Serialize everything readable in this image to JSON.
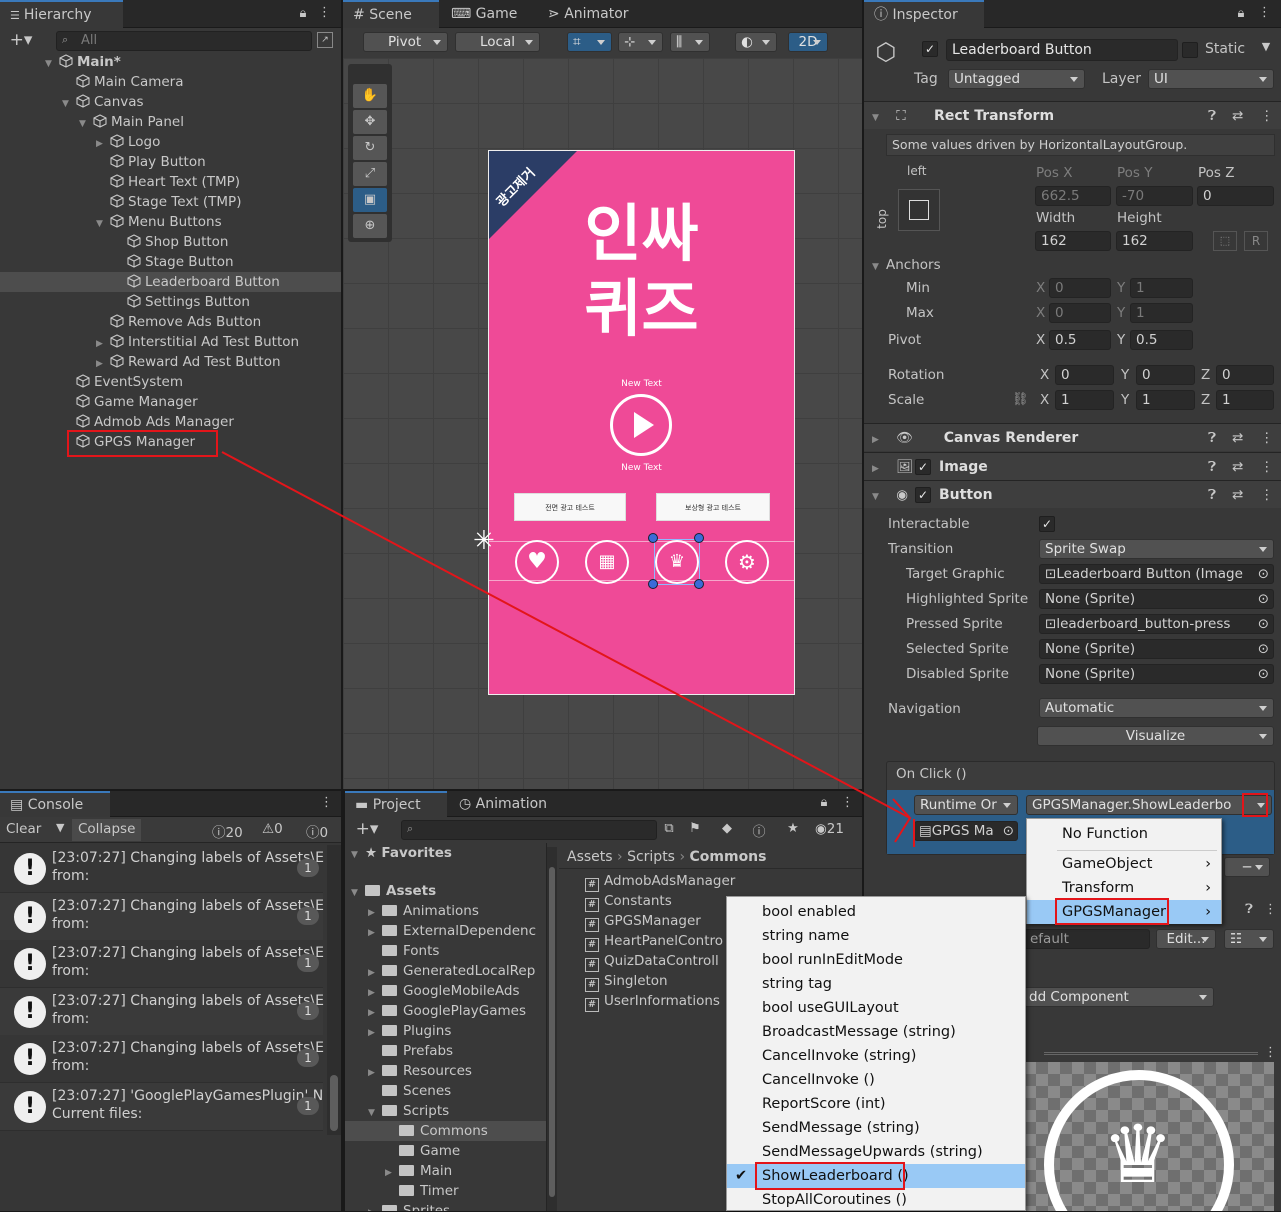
{
  "hierarchy": {
    "tab": "Hierarchy",
    "search_placeholder": "All",
    "items": [
      {
        "label": "Main*",
        "depth": 0,
        "arrow": "down",
        "icon": "unity",
        "bold": true
      },
      {
        "label": "Main Camera",
        "depth": 1,
        "arrow": ""
      },
      {
        "label": "Canvas",
        "depth": 1,
        "arrow": "down"
      },
      {
        "label": "Main Panel",
        "depth": 2,
        "arrow": "down"
      },
      {
        "label": "Logo",
        "depth": 3,
        "arrow": "right"
      },
      {
        "label": "Play Button",
        "depth": 3,
        "arrow": ""
      },
      {
        "label": "Heart Text (TMP)",
        "depth": 3,
        "arrow": ""
      },
      {
        "label": "Stage Text (TMP)",
        "depth": 3,
        "arrow": ""
      },
      {
        "label": "Menu Buttons",
        "depth": 3,
        "arrow": "down"
      },
      {
        "label": "Shop Button",
        "depth": 4,
        "arrow": ""
      },
      {
        "label": "Stage Button",
        "depth": 4,
        "arrow": ""
      },
      {
        "label": "Leaderboard Button",
        "depth": 4,
        "arrow": "",
        "selected": true
      },
      {
        "label": "Settings Button",
        "depth": 4,
        "arrow": ""
      },
      {
        "label": "Remove Ads Button",
        "depth": 3,
        "arrow": ""
      },
      {
        "label": "Interstitial Ad Test Button",
        "depth": 3,
        "arrow": "right"
      },
      {
        "label": "Reward Ad Test Button",
        "depth": 3,
        "arrow": "right"
      },
      {
        "label": "EventSystem",
        "depth": 1,
        "arrow": ""
      },
      {
        "label": "Game Manager",
        "depth": 1,
        "arrow": ""
      },
      {
        "label": "Admob Ads Manager",
        "depth": 1,
        "arrow": ""
      },
      {
        "label": "GPGS Manager",
        "depth": 1,
        "arrow": "",
        "highlighted": true
      }
    ]
  },
  "scene": {
    "tabs": [
      "Scene",
      "Game",
      "Animator"
    ],
    "pivot": "Pivot",
    "local": "Local",
    "mode2d": "2D",
    "game": {
      "corner_text": "광고제거",
      "title_line1": "인싸",
      "title_line2": "퀴즈",
      "text_top": "New Text",
      "text_bottom": "New Text",
      "btn_left": "전면 광고 테스트",
      "btn_right": "보상형 광고 테스트"
    }
  },
  "console": {
    "tab": "Console",
    "clear": "Clear",
    "collapse": "Collapse",
    "count_info": "20",
    "count_warn": "0",
    "count_err": "0",
    "rows": [
      {
        "line1": "[23:07:27] Changing labels of Assets\\E",
        "line2": "from:",
        "count": "1"
      },
      {
        "line1": "[23:07:27] Changing labels of Assets\\E",
        "line2": "from:",
        "count": "1"
      },
      {
        "line1": "[23:07:27] Changing labels of Assets\\E",
        "line2": "from:",
        "count": "1"
      },
      {
        "line1": "[23:07:27] Changing labels of Assets\\E",
        "line2": "from:",
        "count": "1"
      },
      {
        "line1": "[23:07:27] Changing labels of Assets\\E",
        "line2": "from:",
        "count": "1"
      },
      {
        "line1": "[23:07:27] 'GooglePlayGamesPlugin' N",
        "line2": "Current files:",
        "count": "1"
      }
    ]
  },
  "project": {
    "tabs": [
      "Project",
      "Animation"
    ],
    "hidden_count": "21",
    "tree": [
      {
        "label": "Favorites",
        "depth": 0,
        "arrow": "down",
        "star": true,
        "bold": true
      },
      {
        "label": "Assets",
        "depth": 0,
        "arrow": "down",
        "bold": true
      },
      {
        "label": "Animations",
        "depth": 1,
        "arrow": "right"
      },
      {
        "label": "ExternalDependenc",
        "depth": 1,
        "arrow": "right"
      },
      {
        "label": "Fonts",
        "depth": 1,
        "arrow": ""
      },
      {
        "label": "GeneratedLocalRep",
        "depth": 1,
        "arrow": "right"
      },
      {
        "label": "GoogleMobileAds",
        "depth": 1,
        "arrow": "right"
      },
      {
        "label": "GooglePlayGames",
        "depth": 1,
        "arrow": "right"
      },
      {
        "label": "Plugins",
        "depth": 1,
        "arrow": "right"
      },
      {
        "label": "Prefabs",
        "depth": 1,
        "arrow": ""
      },
      {
        "label": "Resources",
        "depth": 1,
        "arrow": "right"
      },
      {
        "label": "Scenes",
        "depth": 1,
        "arrow": ""
      },
      {
        "label": "Scripts",
        "depth": 1,
        "arrow": "down"
      },
      {
        "label": "Commons",
        "depth": 2,
        "arrow": "",
        "selected": true
      },
      {
        "label": "Game",
        "depth": 2,
        "arrow": ""
      },
      {
        "label": "Main",
        "depth": 2,
        "arrow": "right"
      },
      {
        "label": "Timer",
        "depth": 2,
        "arrow": ""
      },
      {
        "label": "Sprites",
        "depth": 1,
        "arrow": "right"
      }
    ],
    "breadcrumb": [
      "Assets",
      "Scripts",
      "Commons"
    ],
    "files": [
      "AdmobAdsManager",
      "Constants",
      "GPGSManager",
      "HeartPanelContro",
      "QuizDataControll",
      "Singleton",
      "UserInformations"
    ]
  },
  "inspector": {
    "tab": "Inspector",
    "object_name": "Leaderboard Button",
    "static_label": "Static",
    "tag_label": "Tag",
    "tag_value": "Untagged",
    "layer_label": "Layer",
    "layer_value": "UI",
    "rect": {
      "title": "Rect Transform",
      "note": "Some values driven by HorizontalLayoutGroup.",
      "anchor_h": "left",
      "anchor_v": "top",
      "posx_label": "Pos X",
      "posy_label": "Pos Y",
      "posz_label": "Pos Z",
      "posx": "662.5",
      "posy": "-70",
      "posz": "0",
      "width_label": "Width",
      "height_label": "Height",
      "width": "162",
      "height": "162",
      "anchors_label": "Anchors",
      "min_label": "Min",
      "max_label": "Max",
      "min_x": "0",
      "min_y": "1",
      "max_x": "0",
      "max_y": "1",
      "pivot_label": "Pivot",
      "pivot_x": "0.5",
      "pivot_y": "0.5",
      "rotation_label": "Rotation",
      "rot_x": "0",
      "rot_y": "0",
      "rot_z": "0",
      "scale_label": "Scale",
      "scale_x": "1",
      "scale_y": "1",
      "scale_z": "1",
      "x": "X",
      "y": "Y",
      "z": "Z",
      "r_btn": "R"
    },
    "canvas_renderer": "Canvas Renderer",
    "image": "Image",
    "button": {
      "title": "Button",
      "interactable": "Interactable",
      "transition": "Transition",
      "transition_value": "Sprite Swap",
      "target_graphic": "Target Graphic",
      "target_graphic_value": "Leaderboard Button (Image",
      "highlighted": "Highlighted Sprite",
      "highlighted_value": "None (Sprite)",
      "pressed": "Pressed Sprite",
      "pressed_value": "leaderboard_button-press",
      "selected": "Selected Sprite",
      "selected_value": "None (Sprite)",
      "disabled": "Disabled Sprite",
      "disabled_value": "None (Sprite)",
      "navigation": "Navigation",
      "navigation_value": "Automatic",
      "visualize": "Visualize",
      "onclick": "On Click ()",
      "runtime": "Runtime Or",
      "function": "GPGSManager.ShowLeaderbo",
      "object_field": "GPGS Ma"
    },
    "material_default": "efault",
    "edit": "Edit...",
    "add_component": "dd Component"
  },
  "context_menu": {
    "items": [
      "No Function",
      "GameObject",
      "Transform",
      "GPGSManager"
    ]
  },
  "method_menu": {
    "items": [
      "bool enabled",
      "string name",
      "bool runInEditMode",
      "string tag",
      "bool useGUILayout",
      "BroadcastMessage (string)",
      "CancelInvoke (string)",
      "CancelInvoke ()",
      "ReportScore (int)",
      "SendMessage (string)",
      "SendMessageUpwards (string)",
      "ShowLeaderboard ()",
      "StopAllCoroutines ()"
    ],
    "checked": "ShowLeaderboard ()"
  },
  "colors": {
    "accent": "#3a79bb",
    "selection": "#2c5d87",
    "game_pink": "#ef4a97",
    "banner_navy": "#2b3d66",
    "annotation_red": "#e3151a",
    "menu_highlight": "#99c9f5"
  }
}
